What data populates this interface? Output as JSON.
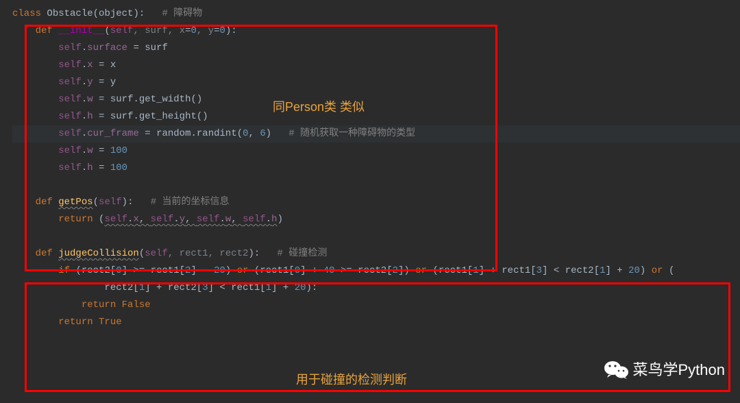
{
  "code": {
    "l1": {
      "kw1": "class ",
      "name": "Obstacle",
      "paren1": "(",
      "obj": "object",
      "paren2": ")",
      "colon": ":",
      "sp": "   ",
      "comment": "# 障碍物"
    },
    "l2": {
      "indent": "    ",
      "kw1": "def ",
      "name": "__init__",
      "paren1": "(",
      "p_self": "self",
      "c1": ", ",
      "p_surf": "surf",
      "c2": ", ",
      "p_x": "x",
      "eq1": "=",
      "n0a": "0",
      "c3": ", ",
      "p_y": "y",
      "eq2": "=",
      "n0b": "0",
      "paren2": ")",
      "colon": ":"
    },
    "l3": {
      "indent": "        ",
      "self": "self",
      "dot": ".",
      "attr": "surface",
      "eq": " = ",
      "val": "surf"
    },
    "l4": {
      "indent": "        ",
      "self": "self",
      "dot": ".",
      "attr": "x",
      "eq": " = ",
      "val": "x"
    },
    "l5": {
      "indent": "        ",
      "self": "self",
      "dot": ".",
      "attr": "y",
      "eq": " = ",
      "val": "y"
    },
    "l6": {
      "indent": "        ",
      "self": "self",
      "dot": ".",
      "attr": "w",
      "eq": " = ",
      "obj": "surf",
      "od": ".",
      "method": "get_width",
      "pp": "()"
    },
    "l7": {
      "indent": "        ",
      "self": "self",
      "dot": ".",
      "attr": "h",
      "eq": " = ",
      "obj": "surf",
      "od": ".",
      "method": "get_height",
      "pp": "()"
    },
    "l8": {
      "indent": "        ",
      "self": "self",
      "dot": ".",
      "attr": "cur_frame",
      "eq": " = ",
      "obj": "random",
      "od": ".",
      "method": "randint",
      "p1": "(",
      "n1": "0",
      "c": ", ",
      "n2": "6",
      "p2": ")",
      "sp": "   ",
      "comment": "# 随机获取一种障碍物的类型"
    },
    "l9": {
      "indent": "        ",
      "self": "self",
      "dot": ".",
      "attr": "w",
      "eq": " = ",
      "val": "100"
    },
    "l10": {
      "indent": "        ",
      "self": "self",
      "dot": ".",
      "attr": "h",
      "eq": " = ",
      "val": "100"
    },
    "l12": {
      "indent": "    ",
      "kw1": "def ",
      "name": "getPos",
      "paren1": "(",
      "p_self": "self",
      "paren2": ")",
      "colon": ":",
      "sp": "   ",
      "comment": "# 当前的坐标信息"
    },
    "l13": {
      "indent": "        ",
      "kw": "return ",
      "p1": "(",
      "s1": "self",
      "d1": ".",
      "a1": "x",
      "c1": ", ",
      "s2": "self",
      "d2": ".",
      "a2": "y",
      "c2": ", ",
      "s3": "self",
      "d3": ".",
      "a3": "w",
      "c3": ", ",
      "s4": "self",
      "d4": ".",
      "a4": "h",
      "p2": ")"
    },
    "l15": {
      "indent": "    ",
      "kw1": "def ",
      "name": "judgeCollision",
      "paren1": "(",
      "p_self": "self",
      "c1": ", ",
      "p1": "rect1",
      "c2": ", ",
      "p2": "rect2",
      "paren2": ")",
      "colon": ":",
      "sp": "   ",
      "comment": "# 碰撞检测"
    },
    "l16": {
      "indent": "        ",
      "kw": "if ",
      "txt1": "(rect2[",
      "n0": "0",
      "txt2": "] >= rect1[",
      "n2": "2",
      "txt3": "] - ",
      "n20": "20",
      "txt4": ") ",
      "or1": "or",
      "txt5": " (rect1[",
      "n0b": "0",
      "txt6": "] + ",
      "n40": "40",
      "txt7": " >= rect2[",
      "n2b": "2",
      "txt8": "]) ",
      "or2": "or",
      "txt9": " (rect1[",
      "n1": "1",
      "txt10": "] + rect1[",
      "n3": "3",
      "txt11": "] < rect2[",
      "n1b": "1",
      "txt12": "] + ",
      "n20b": "20",
      "txt13": ") ",
      "or3": "or",
      "txt14": " ("
    },
    "l17": {
      "indent": "                ",
      "txt1": "rect2[",
      "n1": "1",
      "txt2": "] + rect2[",
      "n3": "3",
      "txt3": "] < rect1[",
      "n1b": "1",
      "txt4": "] + ",
      "n20": "20",
      "txt5": "):"
    },
    "l18": {
      "indent": "            ",
      "kw": "return ",
      "val": "False"
    },
    "l19": {
      "indent": "        ",
      "kw": "return ",
      "val": "True"
    }
  },
  "annotations": {
    "a1": "同Person类 类似",
    "a2": "用于碰撞的检测判断"
  },
  "watermark": "菜鸟学Python"
}
